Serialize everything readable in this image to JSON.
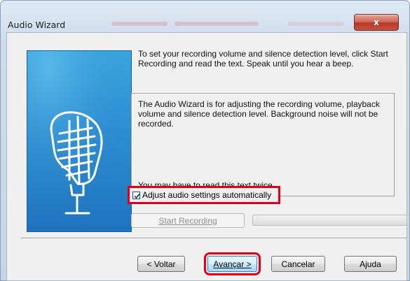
{
  "window": {
    "title": "Audio Wizard",
    "close_label": "x"
  },
  "intro_text": "To set your recording volume and silence detection level, click Start Recording and read the text. Speak until you hear a beep.",
  "read_panel": {
    "text": "The Audio Wizard is for adjusting the recording volume, playback volume and silence detection level. Background noise will not be recorded.",
    "note": "You may have to read this text twice."
  },
  "auto_adjust": {
    "label": "Adjust audio settings automatically",
    "checked": true
  },
  "recording": {
    "start_label": "Start Recording",
    "level": 0
  },
  "buttons": {
    "back": "< Voltar",
    "next": "Avançar >",
    "cancel": "Cancelar",
    "help": "Ajuda"
  },
  "colors": {
    "highlight": "#e0001b",
    "art_blue": "#2b8fd2"
  }
}
